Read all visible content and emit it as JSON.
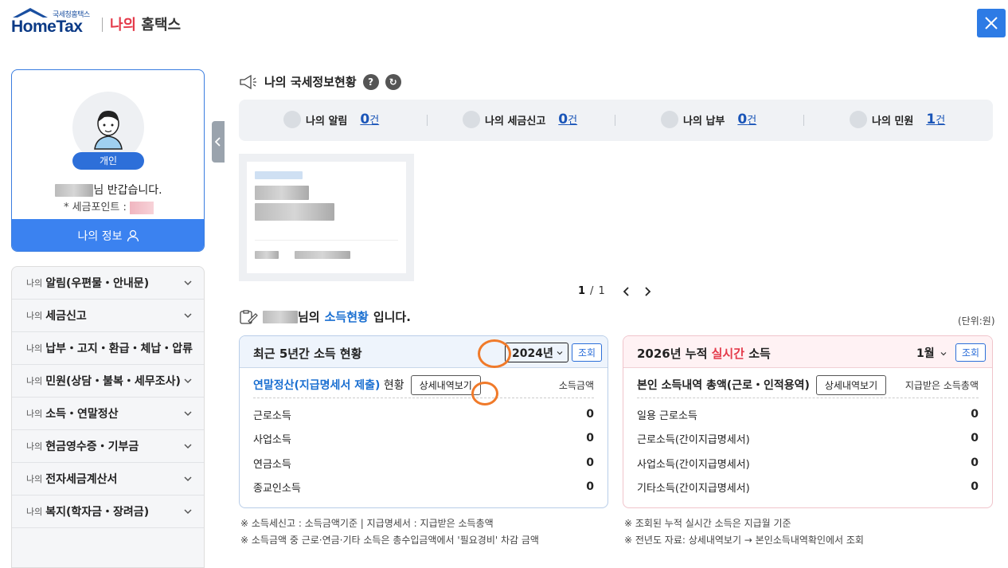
{
  "header": {
    "logo_small": "국세청홈택스",
    "logo_main": "HomeTax",
    "title_accent": "나의",
    "title_rest": "홈택스"
  },
  "profile": {
    "badge": "개인",
    "greeting": "님 반갑습니다.",
    "points_label": "* 세금포인트 :",
    "my_info_label": "나의 정보"
  },
  "menu": {
    "items": [
      {
        "prefix": "나의",
        "label": "알림(우편물・안내문)"
      },
      {
        "prefix": "나의",
        "label": "세금신고"
      },
      {
        "prefix": "나의",
        "label": "납부・고지・환급・체납・압류"
      },
      {
        "prefix": "나의",
        "label": "민원(상담・불복・세무조사)"
      },
      {
        "prefix": "나의",
        "label": "소득・연말정산"
      },
      {
        "prefix": "나의",
        "label": "현금영수증・기부금"
      },
      {
        "prefix": "나의",
        "label": "전자세금계산서"
      },
      {
        "prefix": "나의",
        "label": "복지(학자금・장려금)"
      }
    ]
  },
  "status": {
    "title": "나의 국세정보현황",
    "items": [
      {
        "label": "나의 알림",
        "count": "0",
        "unit": "건"
      },
      {
        "label": "나의 세금신고",
        "count": "0",
        "unit": "건"
      },
      {
        "label": "나의 납부",
        "count": "0",
        "unit": "건"
      },
      {
        "label": "나의 민원",
        "count": "1",
        "unit": "건"
      }
    ]
  },
  "pager": {
    "current": "1",
    "separator": "/",
    "total": "1"
  },
  "income": {
    "title_suffix": "님의",
    "title_highlight": "소득현황",
    "title_end": "입니다.",
    "unit": "(단위:원)",
    "left": {
      "title": "최근 5년간 소득 현황",
      "year": "2024년",
      "view_btn": "조회",
      "sub_blue": "연말정산(지급명세서 제출)",
      "sub_text": "현황",
      "detail_btn": "상세내역보기",
      "col": "소득금액",
      "rows": [
        {
          "label": "근로소득",
          "value": "0"
        },
        {
          "label": "사업소득",
          "value": "0"
        },
        {
          "label": "연금소득",
          "value": "0"
        },
        {
          "label": "종교인소득",
          "value": "0"
        }
      ]
    },
    "right": {
      "title_a": "2026년 누적",
      "title_rt": "실시간",
      "title_b": "소득",
      "month": "1월",
      "view_btn": "조회",
      "sub_text": "본인 소득내역 총액(근로・인적용역)",
      "detail_btn": "상세내역보기",
      "col": "지급받은 소득총액",
      "rows": [
        {
          "label": "일용 근로소득",
          "value": "0"
        },
        {
          "label": "근로소득(간이지급명세서)",
          "value": "0"
        },
        {
          "label": "사업소득(간이지급명세서)",
          "value": "0"
        },
        {
          "label": "기타소득(간이지급명세서)",
          "value": "0"
        }
      ]
    },
    "notes_left": [
      "※ 소득세신고 : 소득금액기준  |  지급명세서 : 지급받은 소득총액",
      "※ 소득금액 중 근로·연금·기타 소득은 총수입금액에서 '필요경비' 차감 금액"
    ],
    "notes_right": [
      "※ 조회된 누적 실시간 소득은 지급월 기준",
      "※ 전년도 자료: 상세내역보기 → 본인소득내역확인에서 조회"
    ]
  }
}
